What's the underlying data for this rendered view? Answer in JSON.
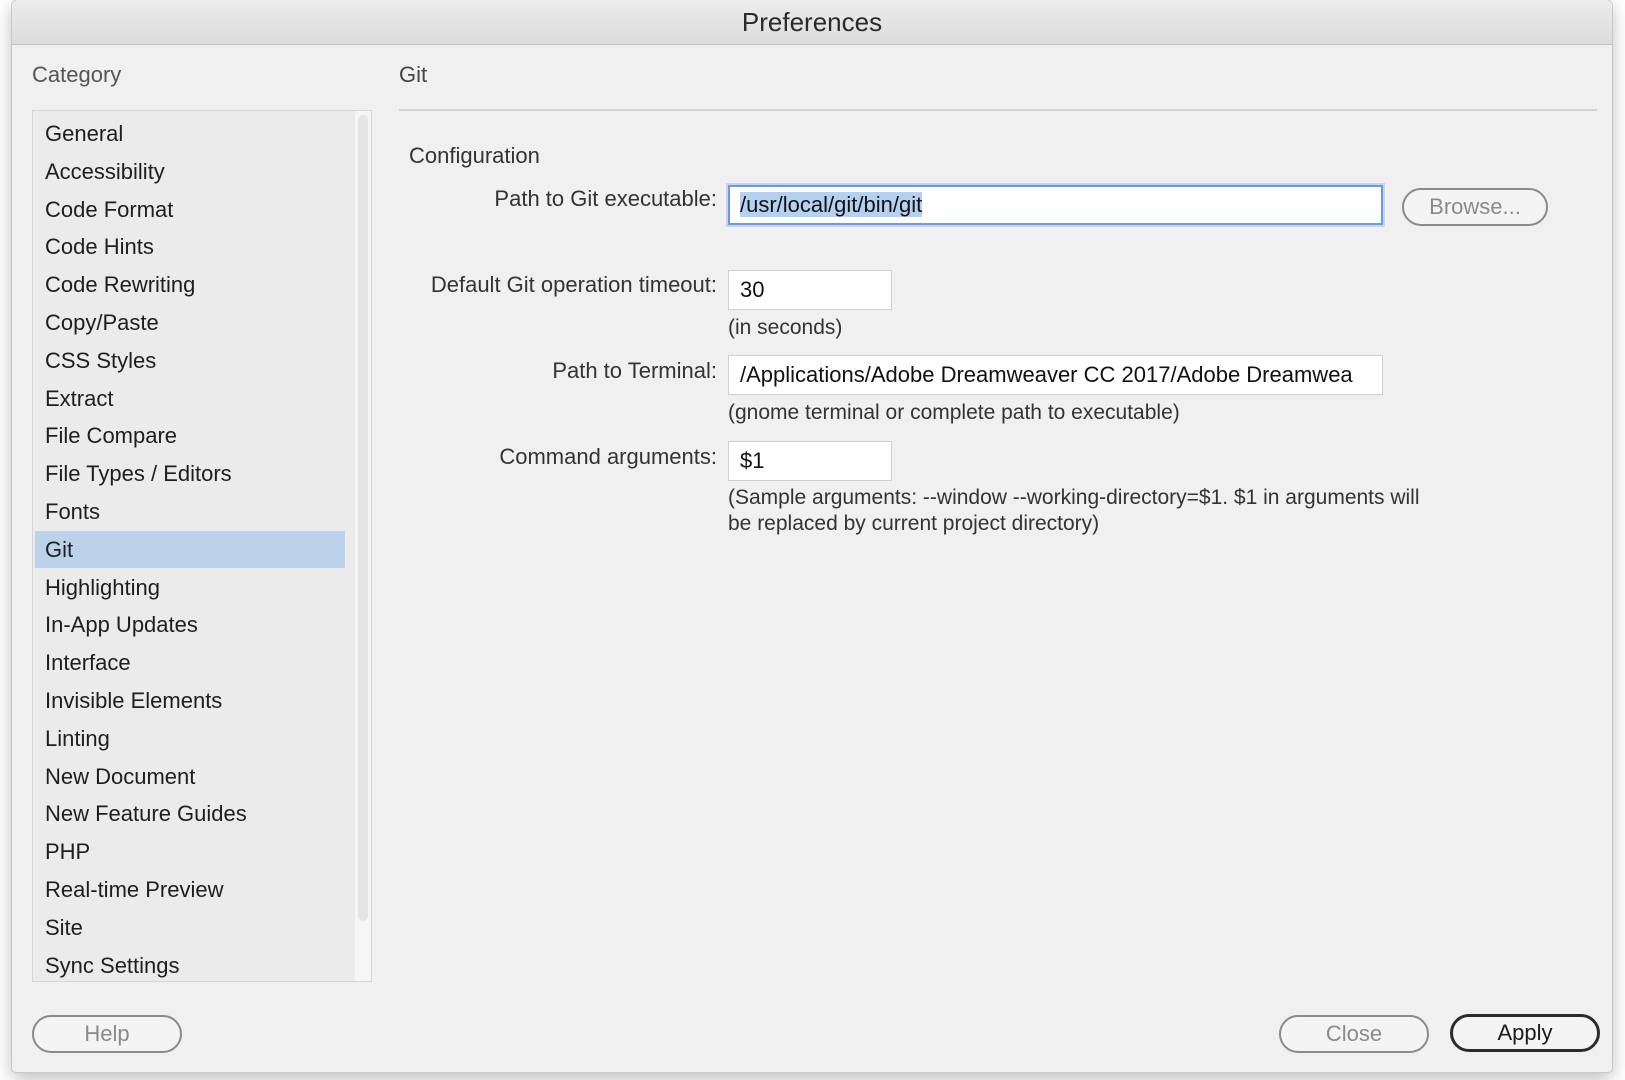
{
  "window": {
    "title": "Preferences"
  },
  "sidebar": {
    "label": "Category",
    "selected": "Git",
    "items": [
      {
        "label": "General"
      },
      {
        "label": "Accessibility"
      },
      {
        "label": "Code Format"
      },
      {
        "label": "Code Hints"
      },
      {
        "label": "Code Rewriting"
      },
      {
        "label": "Copy/Paste"
      },
      {
        "label": "CSS Styles"
      },
      {
        "label": "Extract"
      },
      {
        "label": "File Compare"
      },
      {
        "label": "File Types / Editors"
      },
      {
        "label": "Fonts"
      },
      {
        "label": "Git"
      },
      {
        "label": "Highlighting"
      },
      {
        "label": "In-App Updates"
      },
      {
        "label": "Interface"
      },
      {
        "label": "Invisible Elements"
      },
      {
        "label": "Linting"
      },
      {
        "label": "New Document"
      },
      {
        "label": "New Feature Guides"
      },
      {
        "label": "PHP"
      },
      {
        "label": "Real-time Preview"
      },
      {
        "label": "Site"
      },
      {
        "label": "Sync Settings"
      }
    ]
  },
  "panel": {
    "title": "Git",
    "section": "Configuration",
    "git_path": {
      "label": "Path to Git executable:",
      "value": "/usr/local/git/bin/git",
      "browse_label": "Browse..."
    },
    "timeout": {
      "label": "Default Git operation timeout:",
      "value": "30",
      "hint": "(in seconds)"
    },
    "terminal": {
      "label": "Path to Terminal:",
      "value": "/Applications/Adobe Dreamweaver CC 2017/Adobe Dreamwea",
      "hint": "(gnome terminal or complete path to executable)"
    },
    "arguments": {
      "label": "Command arguments:",
      "value": "$1",
      "hint_line1": "(Sample arguments: --window --working-directory=$1. $1 in arguments will",
      "hint_line2": "be replaced by current project directory)"
    }
  },
  "footer": {
    "help_label": "Help",
    "close_label": "Close",
    "apply_label": "Apply"
  }
}
